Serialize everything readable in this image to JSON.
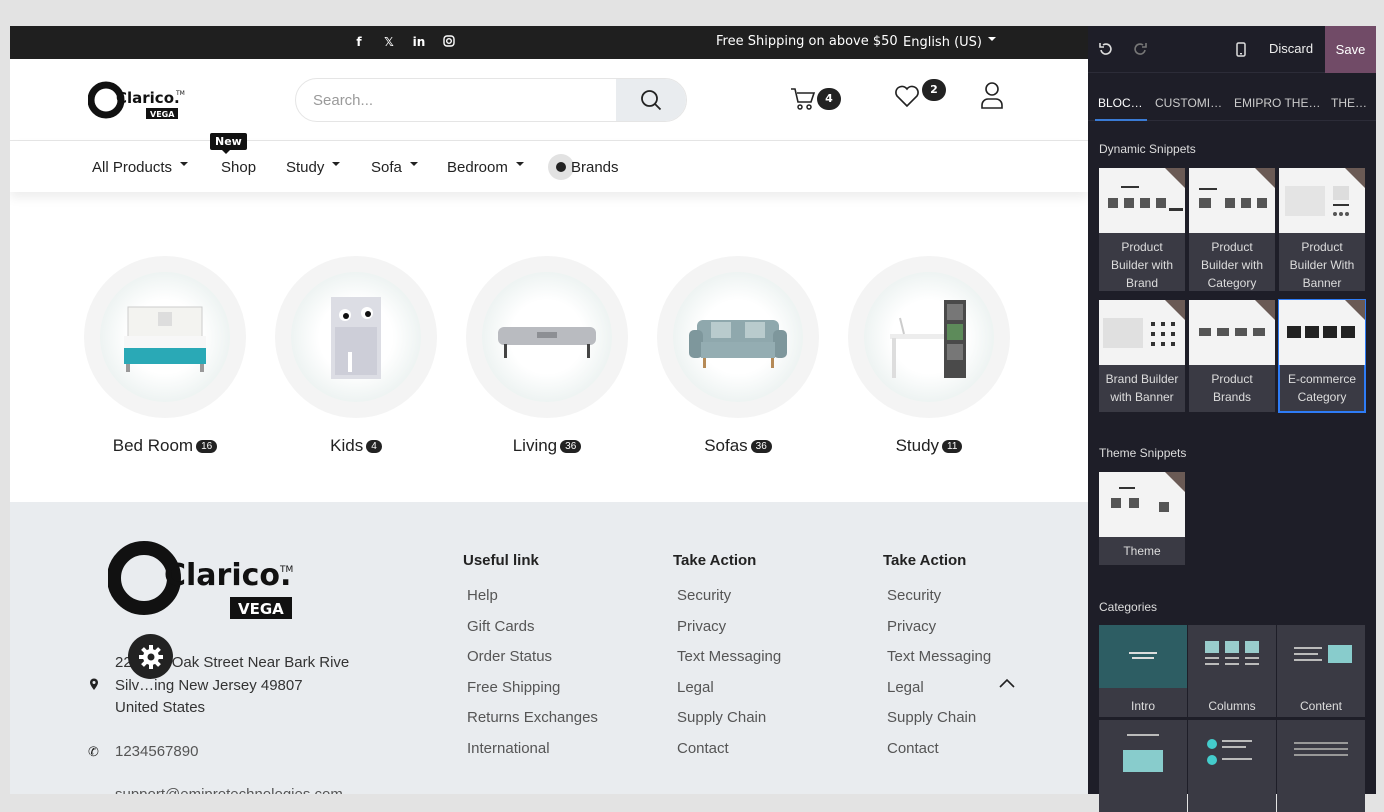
{
  "topbar": {
    "social": [
      "facebook-icon",
      "x-icon",
      "linkedin-icon",
      "instagram-icon"
    ],
    "shipping": "Free Shipping on above $50",
    "language": "English (US)"
  },
  "header": {
    "logo_text": "Clarico.",
    "logo_sub": "VEGA",
    "search_placeholder": "Search...",
    "cart_count": "4",
    "wishlist_count": "2"
  },
  "nav": {
    "items": [
      {
        "label": "All Products"
      },
      {
        "label": "Shop"
      },
      {
        "label": "Study"
      },
      {
        "label": "Sofa"
      },
      {
        "label": "Bedroom"
      },
      {
        "label": "Brands"
      }
    ],
    "new_tag": "New"
  },
  "categories": [
    {
      "name": "Bed Room",
      "count": "16"
    },
    {
      "name": "Kids",
      "count": "4"
    },
    {
      "name": "Living",
      "count": "36"
    },
    {
      "name": "Sofas",
      "count": "36"
    },
    {
      "name": "Study",
      "count": "11"
    }
  ],
  "footer": {
    "address_line1": "2284 … Oak Street Near Bark Rive",
    "address_line2": "Silv…ing New Jersey 49807",
    "address_line3": "United States",
    "phone": "1234567890",
    "email": "support@emiprotechnologies.com",
    "col1": {
      "title": "Useful link",
      "links": [
        "Help",
        "Gift Cards",
        "Order Status",
        "Free Shipping",
        "Returns Exchanges",
        "International"
      ]
    },
    "col2": {
      "title": "Take Action",
      "links": [
        "Security",
        "Privacy",
        "Text Messaging",
        "Legal",
        "Supply Chain",
        "Contact"
      ]
    },
    "col3": {
      "title": "Take Action",
      "links": [
        "Security",
        "Privacy",
        "Text Messaging",
        "Legal",
        "Supply Chain",
        "Contact"
      ]
    }
  },
  "editor": {
    "discard": "Discard",
    "save": "Save",
    "tabs": [
      "BLOC…",
      "CUSTOMI…",
      "EMIPRO THE…",
      "THE…"
    ],
    "dynamic_title": "Dynamic Snippets",
    "dynamic": [
      "Product Builder with Brand",
      "Product Builder with Category",
      "Product Builder With Banner",
      "Brand Builder with Banner",
      "Product Brands",
      "E-commerce Category"
    ],
    "theme_title": "Theme Snippets",
    "theme": [
      "Theme"
    ],
    "categories_title": "Categories",
    "categories": [
      "Intro",
      "Columns",
      "Content",
      "",
      "",
      " "
    ]
  }
}
